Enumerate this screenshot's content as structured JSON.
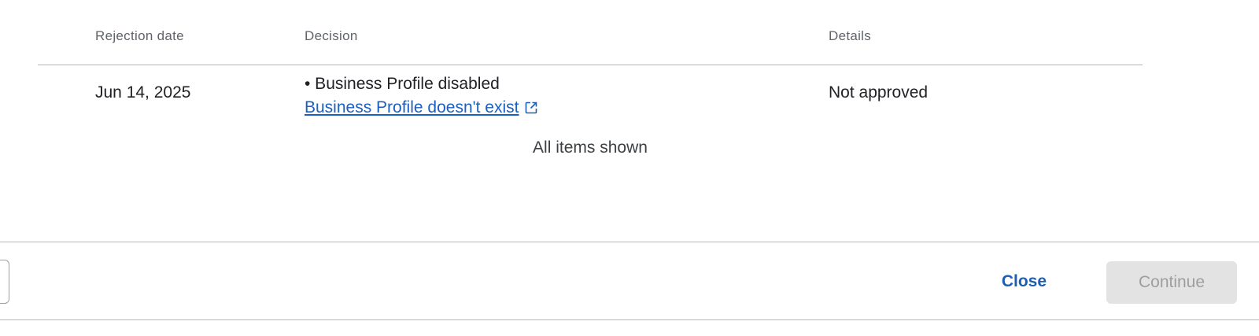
{
  "table": {
    "headers": {
      "rejection_date": "Rejection date",
      "decision": "Decision",
      "details": "Details"
    },
    "rows": [
      {
        "rejection_date": "Jun 14, 2025",
        "decision_reason": "• Business Profile disabled",
        "decision_link": "Business Profile doesn't exist",
        "details": "Not approved"
      }
    ],
    "status": "All items shown"
  },
  "footer": {
    "close_label": "Close",
    "continue_label": "Continue"
  },
  "icons": {
    "external_link": "external-link-icon"
  },
  "colors": {
    "link": "#1a5fb4",
    "disabled_button_bg": "#e3e3e3",
    "disabled_button_text": "#9e9e9e"
  }
}
